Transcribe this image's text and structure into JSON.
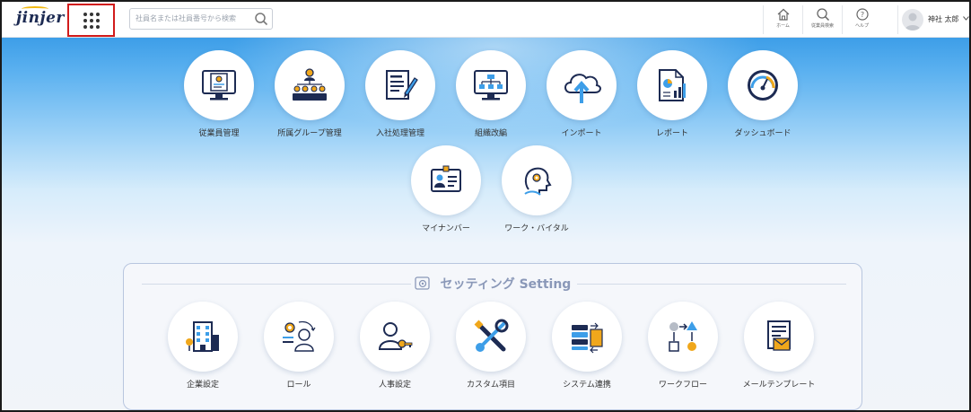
{
  "header": {
    "logo": "jinjer",
    "search_placeholder": "社員名または社員番号から検索",
    "buttons": [
      {
        "label": "ホーム",
        "icon": "home-icon"
      },
      {
        "label": "従業員検索",
        "icon": "search-icon"
      },
      {
        "label": "ヘルプ",
        "icon": "help-icon"
      }
    ],
    "user_name": "神社 太郎"
  },
  "apps": [
    {
      "label": "従業員管理",
      "icon": "employee-monitor-icon"
    },
    {
      "label": "所属グループ管理",
      "icon": "org-group-icon"
    },
    {
      "label": "入社処理管理",
      "icon": "document-pen-icon"
    },
    {
      "label": "組織改編",
      "icon": "org-chart-monitor-icon"
    },
    {
      "label": "インポート",
      "icon": "cloud-upload-icon"
    },
    {
      "label": "レポート",
      "icon": "report-chart-icon"
    },
    {
      "label": "ダッシュボード",
      "icon": "gauge-icon"
    },
    {
      "label": "マイナンバー",
      "icon": "id-card-icon"
    },
    {
      "label": "ワーク・バイタル",
      "icon": "head-gear-icon"
    }
  ],
  "settings": {
    "title": "セッティング Setting",
    "items": [
      {
        "label": "企業設定",
        "icon": "building-icon"
      },
      {
        "label": "ロール",
        "icon": "role-icon"
      },
      {
        "label": "人事設定",
        "icon": "user-key-icon"
      },
      {
        "label": "カスタム項目",
        "icon": "tools-icon"
      },
      {
        "label": "システム連携",
        "icon": "system-link-icon"
      },
      {
        "label": "ワークフロー",
        "icon": "workflow-icon"
      },
      {
        "label": "メールテンプレート",
        "icon": "mail-template-icon"
      }
    ]
  },
  "colors": {
    "accent_blue": "#3d9ee8",
    "navy": "#1d2b53",
    "orange": "#f0a71b",
    "highlight_red": "#d11b1b"
  }
}
